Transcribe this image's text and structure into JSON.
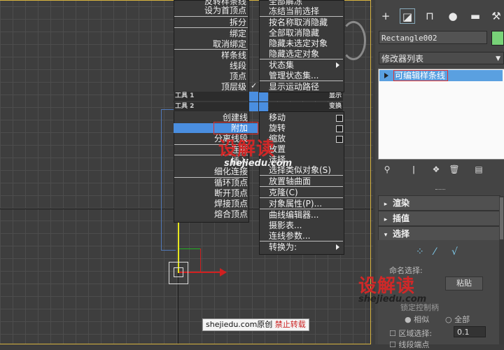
{
  "left_menu": {
    "items_top": [
      "反转样条线",
      "设为首顶点",
      "拆分",
      "绑定",
      "取消绑定",
      "样条线",
      "线段",
      "顶点",
      "顶层级"
    ],
    "header1": "工具 1",
    "header2": "工具 2",
    "items_bottom": [
      "创建线",
      "附加",
      "分离线段",
      "连接",
      "插入",
      "细化连接",
      "循环顶点",
      "断开顶点",
      "焊接顶点",
      "熔合顶点"
    ],
    "highlighted": "附加"
  },
  "right_menu": {
    "items_top": [
      "全部解冻",
      "冻结当前选择",
      "按名称取消隐藏",
      "全部取消隐藏",
      "隐藏未选定对象",
      "隐藏选定对象",
      "状态集",
      "管理状态集...",
      "显示运动路径"
    ],
    "header1": "显示",
    "header2": "变换",
    "items_bottom": [
      "移动",
      "旋转",
      "缩放",
      "放置",
      "选择",
      "选择类似对象(S)",
      "放置轴曲面",
      "克隆(C)",
      "对象属性(P)...",
      "曲线编辑器...",
      "摄影表...",
      "连线参数...",
      "转换为:"
    ]
  },
  "panel": {
    "tab_icons": [
      "plus-icon",
      "modify-icon",
      "hierarchy-icon",
      "motion-icon",
      "display-icon",
      "utilities-icon"
    ],
    "object_name": "Rectangle002",
    "object_color": "#78d278",
    "modifier_list": "修改器列表",
    "stack_item": "可编辑样条线",
    "rollouts": [
      "渲染",
      "插值",
      "选择"
    ],
    "selection_label": "命名选择:",
    "paste_button": "粘贴",
    "lock_handles": "锁定控制柄",
    "radio_similar": "相似",
    "radio_all": "全部",
    "area_select": "区域选择:",
    "area_value": "0.1",
    "segment_end": "线段端点"
  },
  "watermarks": {
    "logo_text": "设解读",
    "url": "shejiedu.com",
    "credit_prefix": "shejiedu.com原创",
    "credit_suffix": "禁止转载"
  }
}
